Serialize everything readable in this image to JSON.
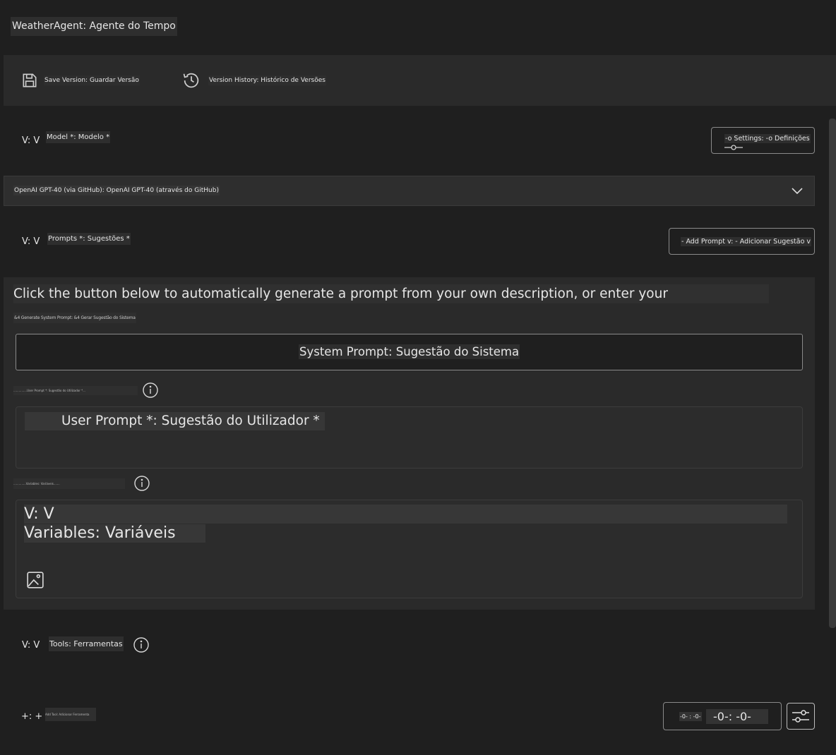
{
  "app": {
    "title": "WeatherAgent: Agente do Tempo"
  },
  "toolbar": {
    "save_label": "Save Version: Guardar Versão",
    "history_label": "Version History: Histórico de Versões"
  },
  "model": {
    "prefix": "V: V",
    "label": "Model *: Modelo *",
    "settings_label": "-o Settings: -o Definições",
    "selected": "OpenAI GPT-40 (via GitHub): OpenAI GPT-40 (através do GitHub)"
  },
  "prompts": {
    "prefix": "V: V",
    "label": "Prompts *: Sugestões *",
    "add_label": "- Add Prompt v: - Adicionar Sugestão v",
    "instructions": "Click the button below to automatically generate a prompt from your own description, or enter your",
    "generate_label": "&4 Generate System Prompt: &4 Gerar Sugestão do Sistema",
    "system_prompt_label": "System Prompt: Sugestão do Sistema",
    "user_prompt_caption": "...............User Prompt *: Sugestão do Utilizador *...",
    "user_prompt_placeholder": "User Prompt *: Sugestão do Utilizador *",
    "variables_caption": "..............Variables: Variáveis.......",
    "variables_prefix": "V: V",
    "variables_label": "Variables: Variáveis"
  },
  "tools": {
    "prefix": "V: V",
    "label": "Tools: Ferramentas"
  },
  "footer": {
    "add_prefix": "+: +",
    "add_label": "Add Tool: Adicionar Ferramenta",
    "counter_small": "-0- : -0-",
    "counter_large": "-0-: -0-"
  }
}
